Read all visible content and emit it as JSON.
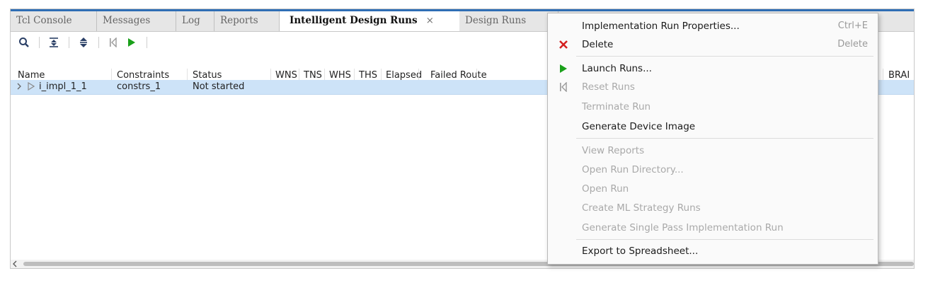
{
  "tabs": [
    {
      "label": "Tcl Console"
    },
    {
      "label": "Messages"
    },
    {
      "label": "Log"
    },
    {
      "label": "Reports"
    },
    {
      "label": "Intelligent Design Runs",
      "close": "×"
    },
    {
      "label": "Design Runs"
    }
  ],
  "columns": [
    "Name",
    "Constraints",
    "Status",
    "WNS",
    "TNS",
    "WHS",
    "THS",
    "Elapsed",
    "Failed Route",
    "BRAI"
  ],
  "row": {
    "name": "i_impl_1_1",
    "constraints": "constrs_1",
    "status": "Not started"
  },
  "menu": {
    "items": [
      {
        "label": "Implementation Run Properties...",
        "shortcut": "Ctrl+E"
      },
      {
        "label": "Delete",
        "shortcut": "Delete"
      },
      {
        "label": "Launch Runs..."
      },
      {
        "label": "Reset Runs"
      },
      {
        "label": "Terminate Run"
      },
      {
        "label": "Generate Device Image"
      },
      {
        "label": "View Reports"
      },
      {
        "label": "Open Run Directory..."
      },
      {
        "label": "Open Run"
      },
      {
        "label": "Create ML Strategy Runs"
      },
      {
        "label": "Generate Single Pass Implementation Run"
      },
      {
        "label": "Export to Spreadsheet..."
      }
    ]
  },
  "colors": {
    "accent": "#2f6eb5",
    "selection": "#cde3f8",
    "run_green": "#1aa01a",
    "delete_red": "#d42020"
  }
}
